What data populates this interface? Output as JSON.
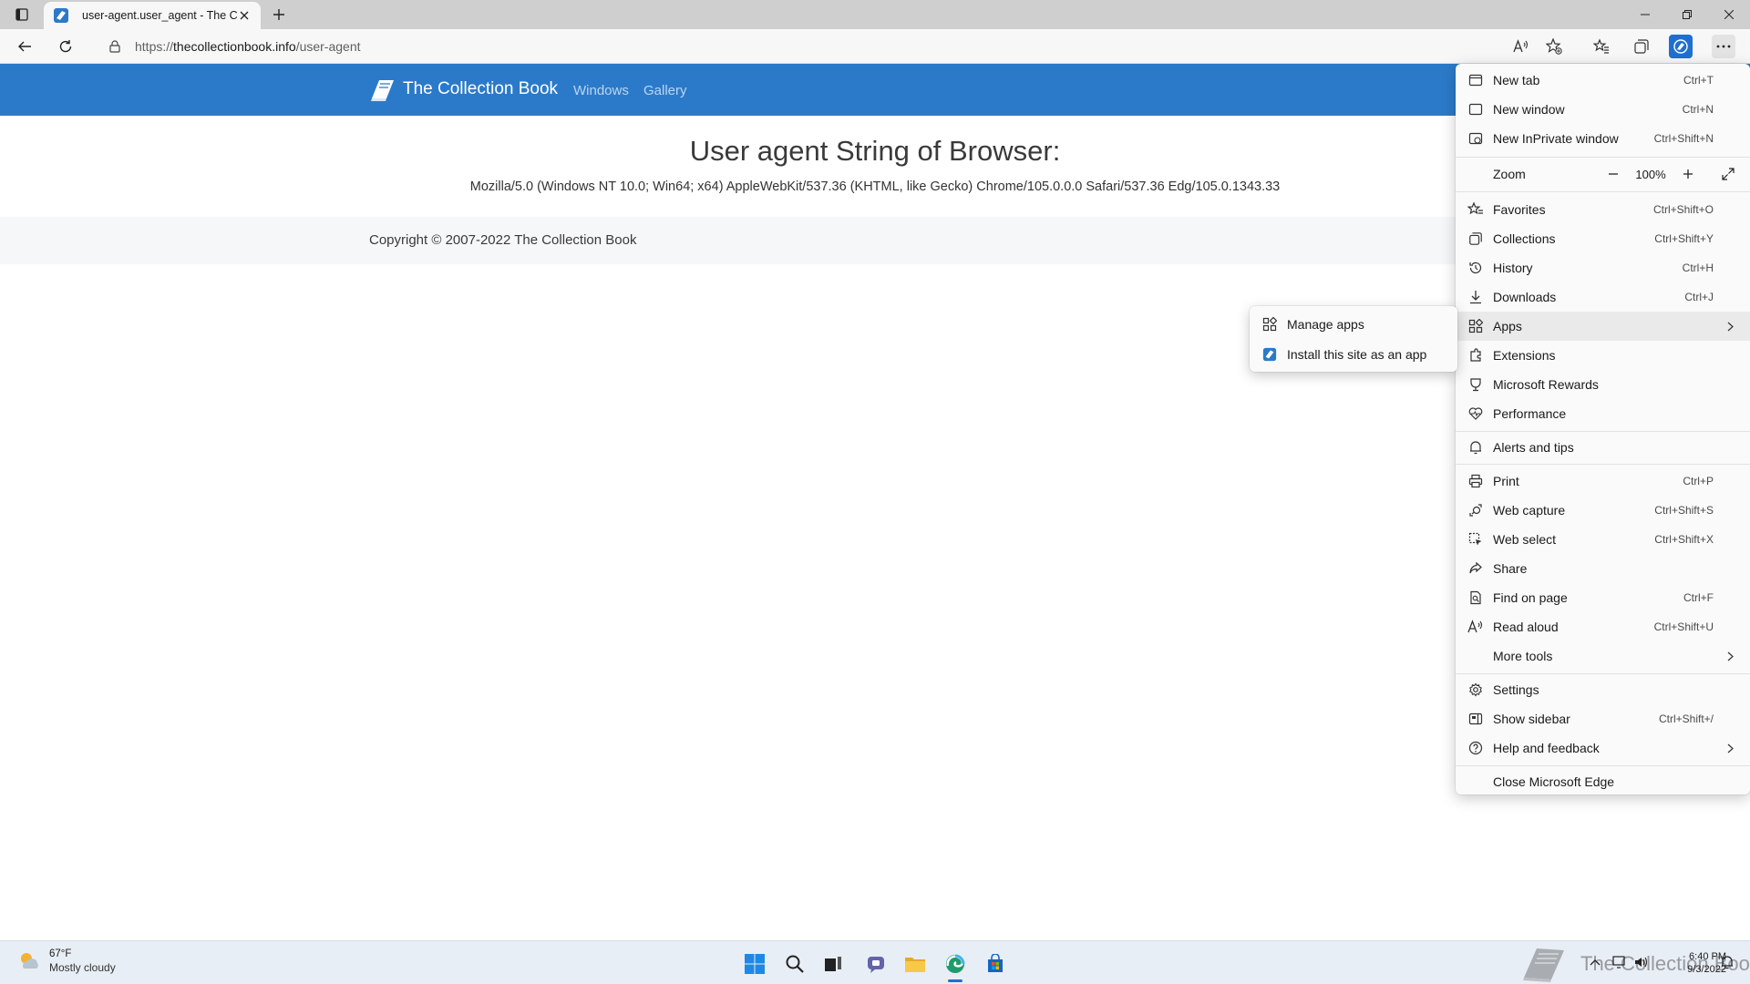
{
  "tab": {
    "title": "user-agent.user_agent - The Coll",
    "favicon": "collection-book-favicon"
  },
  "address_bar": {
    "url_scheme": "https://",
    "url_host": "thecollectionbook.info",
    "url_path": "/user-agent"
  },
  "site": {
    "brand": "The Collection Book",
    "nav": [
      "Windows",
      "Gallery"
    ],
    "heading": "User agent String of Browser:",
    "user_agent": "Mozilla/5.0 (Windows NT 10.0; Win64; x64) AppleWebKit/537.36 (KHTML, like Gecko) Chrome/105.0.0.0 Safari/537.36 Edg/105.0.1343.33",
    "copyright": "Copyright © 2007-2022 The Collection Book"
  },
  "menu": {
    "items": [
      {
        "label": "New tab",
        "shortcut": "Ctrl+T",
        "icon": "new-tab-icon"
      },
      {
        "label": "New window",
        "shortcut": "Ctrl+N",
        "icon": "new-window-icon"
      },
      {
        "label": "New InPrivate window",
        "shortcut": "Ctrl+Shift+N",
        "icon": "inprivate-icon"
      },
      {
        "label": "Zoom",
        "value": "100%"
      },
      {
        "label": "Favorites",
        "shortcut": "Ctrl+Shift+O",
        "icon": "favorites-icon"
      },
      {
        "label": "Collections",
        "shortcut": "Ctrl+Shift+Y",
        "icon": "collections-icon"
      },
      {
        "label": "History",
        "shortcut": "Ctrl+H",
        "icon": "history-icon"
      },
      {
        "label": "Downloads",
        "shortcut": "Ctrl+J",
        "icon": "downloads-icon"
      },
      {
        "label": "Apps",
        "icon": "apps-icon",
        "submenu": true
      },
      {
        "label": "Extensions",
        "icon": "extensions-icon"
      },
      {
        "label": "Microsoft Rewards",
        "icon": "rewards-icon"
      },
      {
        "label": "Performance",
        "icon": "performance-icon"
      },
      {
        "label": "Alerts and tips",
        "icon": "bell-icon"
      },
      {
        "label": "Print",
        "shortcut": "Ctrl+P",
        "icon": "print-icon"
      },
      {
        "label": "Web capture",
        "shortcut": "Ctrl+Shift+S",
        "icon": "web-capture-icon"
      },
      {
        "label": "Web select",
        "shortcut": "Ctrl+Shift+X",
        "icon": "web-select-icon"
      },
      {
        "label": "Share",
        "icon": "share-icon"
      },
      {
        "label": "Find on page",
        "shortcut": "Ctrl+F",
        "icon": "find-icon"
      },
      {
        "label": "Read aloud",
        "shortcut": "Ctrl+Shift+U",
        "icon": "read-aloud-icon"
      },
      {
        "label": "More tools",
        "submenu": true
      },
      {
        "label": "Settings",
        "icon": "settings-icon"
      },
      {
        "label": "Show sidebar",
        "shortcut": "Ctrl+Shift+/",
        "icon": "sidebar-icon"
      },
      {
        "label": "Help and feedback",
        "icon": "help-icon",
        "submenu": true
      },
      {
        "label": "Close Microsoft Edge"
      }
    ]
  },
  "apps_submenu": {
    "items": [
      {
        "label": "Manage apps",
        "icon": "apps-icon"
      },
      {
        "label": "Install this site as an app",
        "icon": "collection-book-favicon"
      }
    ]
  },
  "taskbar": {
    "weather_temp": "67°F",
    "weather_condition": "Mostly cloudy",
    "watermark": "The Collection Book",
    "time": "6:40 PM",
    "date": "9/3/2022"
  },
  "colors": {
    "site_header": "#2b7ac9",
    "accent": "#1e6fd0"
  }
}
